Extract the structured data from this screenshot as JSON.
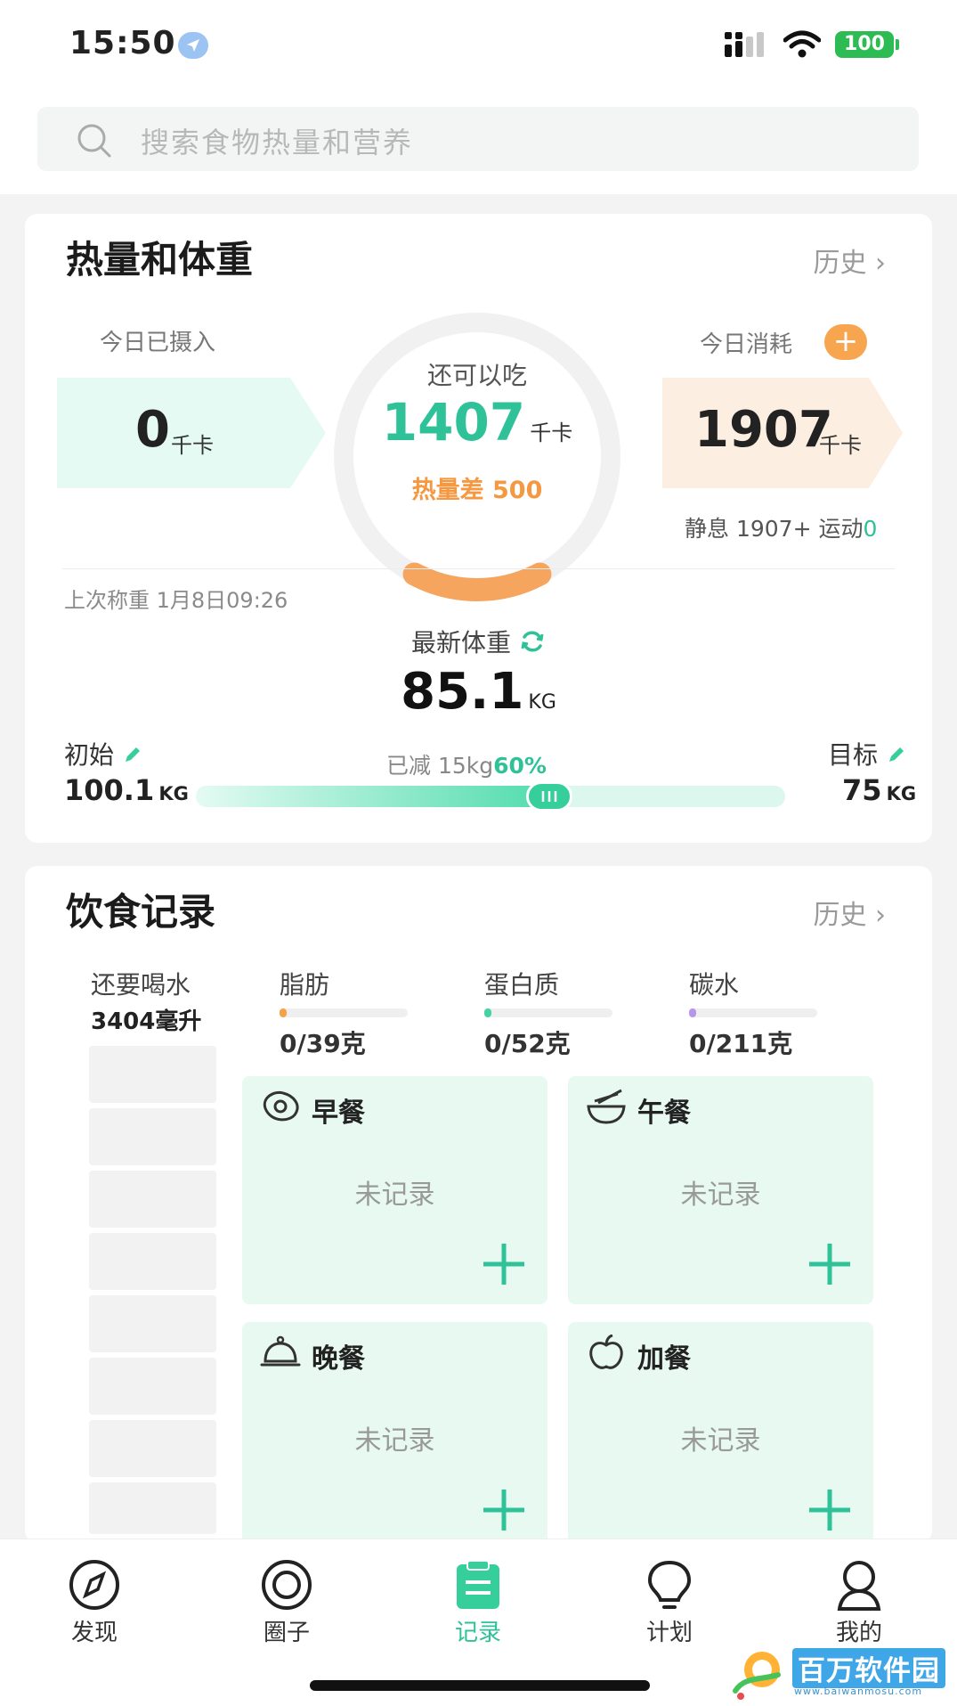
{
  "status_bar": {
    "time": "15:50",
    "battery": "100"
  },
  "search": {
    "placeholder": "搜索食物热量和营养"
  },
  "calorie_card": {
    "title": "热量和体重",
    "history_label": "历史",
    "intake_label": "今日已摄入",
    "intake_value": "0",
    "intake_unit": "千卡",
    "remaining_label": "还可以吃",
    "remaining_value": "1407",
    "remaining_unit": "千卡",
    "deficit_text": "热量差 500",
    "burn_label": "今日消耗",
    "burn_value": "1907",
    "burn_unit": "千卡",
    "burn_detail": "静息 1907+ 运动",
    "exercise_value": "0",
    "last_weigh": "上次称重 1月8日09:26",
    "latest_label": "最新体重",
    "latest_weight": "85.1",
    "weight_unit": "KG",
    "start_label": "初始",
    "start_weight": "100.1",
    "target_label": "目标",
    "target_weight": "75",
    "lost_text": "已减 15kg",
    "progress_text": "60%",
    "progress": 0.6
  },
  "diet_card": {
    "title": "饮食记录",
    "history_label": "历史",
    "water_label": "还要喝水",
    "water_value": "3404毫升",
    "nutrients": [
      {
        "name": "脂肪",
        "value": "0/39克",
        "color": "#f5a24a"
      },
      {
        "name": "蛋白质",
        "value": "0/52克",
        "color": "#45d3a5"
      },
      {
        "name": "碳水",
        "value": "0/211克",
        "color": "#b795ec"
      }
    ],
    "meals": [
      {
        "name": "早餐",
        "status": "未记录",
        "icon": "egg-icon"
      },
      {
        "name": "午餐",
        "status": "未记录",
        "icon": "bowl-icon"
      },
      {
        "name": "晚餐",
        "status": "未记录",
        "icon": "cloche-icon"
      },
      {
        "name": "加餐",
        "status": "未记录",
        "icon": "apple-icon"
      }
    ]
  },
  "tabbar": {
    "tabs": [
      {
        "label": "发现",
        "icon": "compass-icon"
      },
      {
        "label": "圈子",
        "icon": "circle-icon"
      },
      {
        "label": "记录",
        "icon": "clipboard-icon"
      },
      {
        "label": "计划",
        "icon": "bulb-icon"
      },
      {
        "label": "我的",
        "icon": "user-icon"
      }
    ],
    "active_index": 2
  },
  "watermark": {
    "text": "百万软件园",
    "sub": "www.baiwanmosu.com"
  },
  "colors": {
    "accent": "#2fc197",
    "orange": "#f59842",
    "mint_bg": "#e7f9f1"
  }
}
